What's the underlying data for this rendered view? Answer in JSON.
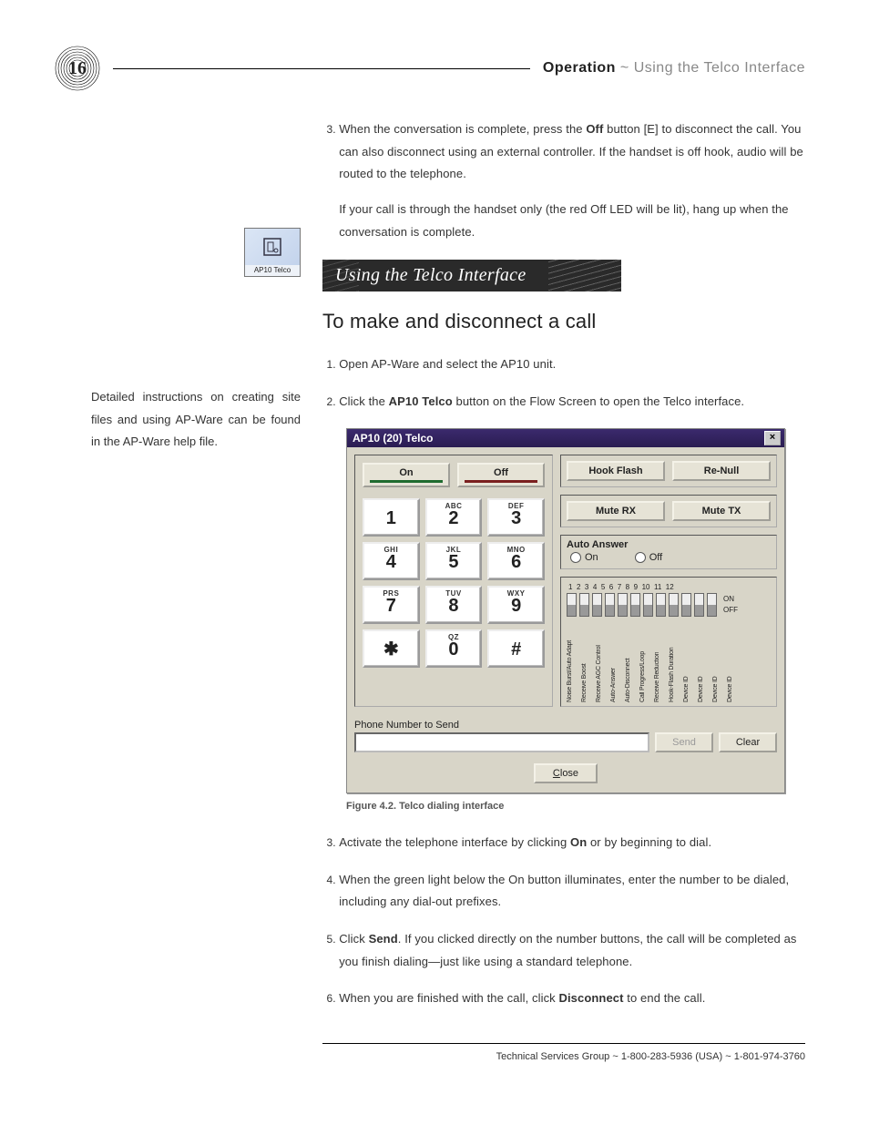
{
  "page_number": "16",
  "header": {
    "bold": "Operation",
    "sep": "~",
    "light": "Using the Telco Interface"
  },
  "intro": {
    "step3_pre": "When the conversation is complete, press the ",
    "step3_bold": "Off",
    "step3_post": " button [E] to disconnect the call. You can also disconnect using an external controller. If the handset is off hook, audio will be routed to the telephone.",
    "para2": "If your call is through the handset only (the red Off LED will be lit), hang up when the conversation is complete."
  },
  "banner": "Using the Telco Interface",
  "subhead": "To make and disconnect a call",
  "steps": {
    "s1": "Open AP-Ware and select the AP10 unit.",
    "s2_pre": "Click the ",
    "s2_bold": "AP10 Telco",
    "s2_post": " button on the Flow Screen to open the Telco interface.",
    "s3_pre": "Activate the telephone interface by clicking ",
    "s3_bold": "On",
    "s3_post": " or by beginning to dial.",
    "s4": "When the green light below the On button illuminates, enter the number to be dialed, including any dial-out prefixes.",
    "s5_pre": "Click ",
    "s5_bold": "Send",
    "s5_post": ". If you clicked directly on the number buttons, the call will be completed as you finish dialing—just like using a standard telephone.",
    "s6_pre": "When you are finished with the call, click ",
    "s6_bold": "Disconnect",
    "s6_post": " to end the call."
  },
  "sidebar": {
    "icon_caption": "AP10 Telco",
    "note": "Detailed instructions on creating site files and using AP-Ware can be found in the AP-Ware help file."
  },
  "dialog": {
    "title": "AP10 (20) Telco",
    "on": "On",
    "off": "Off",
    "hook_flash": "Hook Flash",
    "re_null": "Re-Null",
    "mute_rx": "Mute RX",
    "mute_tx": "Mute TX",
    "auto_answer": "Auto Answer",
    "aa_on": "On",
    "aa_off": "Off",
    "keys": {
      "k1": "1",
      "k2a": "ABC",
      "k2": "2",
      "k3a": "DEF",
      "k3": "3",
      "k4a": "GHI",
      "k4": "4",
      "k5a": "JKL",
      "k5": "5",
      "k6a": "MNO",
      "k6": "6",
      "k7a": "PRS",
      "k7": "7",
      "k8a": "TUV",
      "k8": "8",
      "k9a": "WXY",
      "k9": "9",
      "kS": "✱",
      "k0a": "QZ",
      "k0": "0",
      "kH": "#"
    },
    "dip_on": "ON",
    "dip_off": "OFF",
    "dip_nums": [
      "1",
      "2",
      "3",
      "4",
      "5",
      "6",
      "7",
      "8",
      "9",
      "10",
      "11",
      "12"
    ],
    "dip_labels": [
      "Noise Burst/Auto Adapt",
      "Receive Boost",
      "Receive AGC Control",
      "Auto-Answer",
      "Auto-Disconnect",
      "Call Progress/Loop",
      "Receive Reduction",
      "Hook-Flash Duration",
      "Device ID",
      "Device ID",
      "Device ID",
      "Device ID"
    ],
    "phone_label": "Phone Number to Send",
    "send": "Send",
    "clear": "Clear",
    "close": "Close",
    "close_u": "C"
  },
  "figure_caption": "Figure 4.2. Telco dialing interface",
  "footer": {
    "group": "Technical Services Group",
    "sep": " ~ ",
    "phone1": "1-800-283-5936 (USA)",
    "phone2": "1-801-974-3760"
  }
}
